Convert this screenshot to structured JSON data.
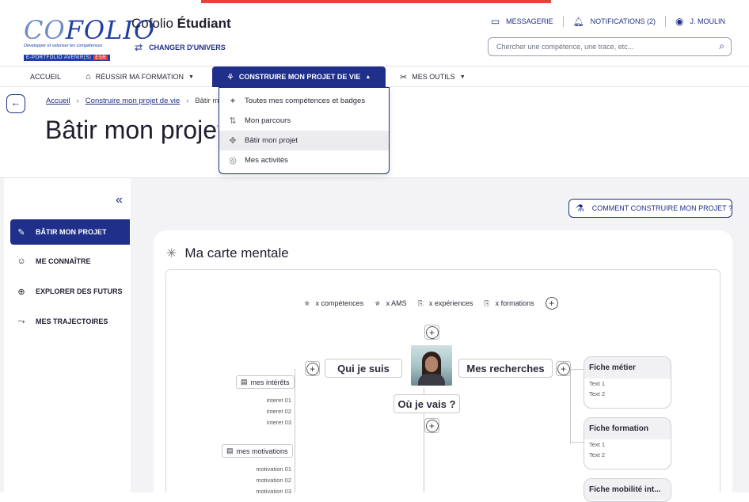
{
  "header": {
    "logo": {
      "word_a": "CO",
      "word_b": "FOLIO",
      "tagline": "Développer et valoriser les compétences",
      "band": "E-PORTFOLIO AVENIR(S)",
      "band_tag": "ESR"
    },
    "app_title_prefix": "Cofolio ",
    "app_title_strong": "Étudiant",
    "switch_label": "CHANGER D'UNIVERS",
    "messagerie": "MESSAGERIE",
    "notifications": "NOTIFICATIONS (2)",
    "user": "J. MOULIN",
    "search_placeholder": "Chercher une compétence, une trace, etc..."
  },
  "nav": {
    "accueil": "ACCUEIL",
    "reussir": "RÉUSSIR MA FORMATION",
    "construire": "CONSTRUIRE MON PROJET DE VIE",
    "outils": "MES OUTILS"
  },
  "dropdown": [
    {
      "icon": "sparkle-icon",
      "glyph": "✦",
      "label": "Toutes mes compétences et badges"
    },
    {
      "icon": "route-icon",
      "glyph": "⇅",
      "label": "Mon parcours"
    },
    {
      "icon": "build-icon",
      "glyph": "✥",
      "label": "Bâtir mon projet"
    },
    {
      "icon": "activity-icon",
      "glyph": "◎",
      "label": "Mes activités"
    }
  ],
  "breadcrumb": {
    "home": "Accueil",
    "section": "Construire mon projet de vie",
    "current": "Bâtir mon projet"
  },
  "page_title": "Bâtir mon projet",
  "sidebar": {
    "items": [
      {
        "label": "BÂTIR MON PROJET"
      },
      {
        "label": "ME CONNAÎTRE"
      },
      {
        "label": "EXPLORER DES FUTURS"
      },
      {
        "label": "MES TRAJECTOIRES"
      }
    ]
  },
  "howto_label": "COMMENT CONSTRUIRE MON PROJET ?",
  "mindmap": {
    "title": "Ma carte mentale",
    "legend": [
      "x compétences",
      "x AMS",
      "x expériences",
      "x formations"
    ],
    "center_left": "Qui je suis",
    "center_right": "Mes recherches",
    "center_bottom": "Où je vais ?",
    "interets_label": "mes intérêts",
    "interets": [
      "interet 01",
      "interet 02",
      "interet 03"
    ],
    "motivations_label": "mes motivations",
    "motivations": [
      "motivation 01",
      "motivation 02",
      "motivation 03"
    ],
    "fiches": [
      {
        "title": "Fiche métier",
        "lines": [
          "Text 1",
          "Text 2"
        ]
      },
      {
        "title": "Fiche formation",
        "lines": [
          "Text 1",
          "Text 2"
        ]
      },
      {
        "title": "Fiche mobilité int...",
        "lines": []
      }
    ]
  }
}
